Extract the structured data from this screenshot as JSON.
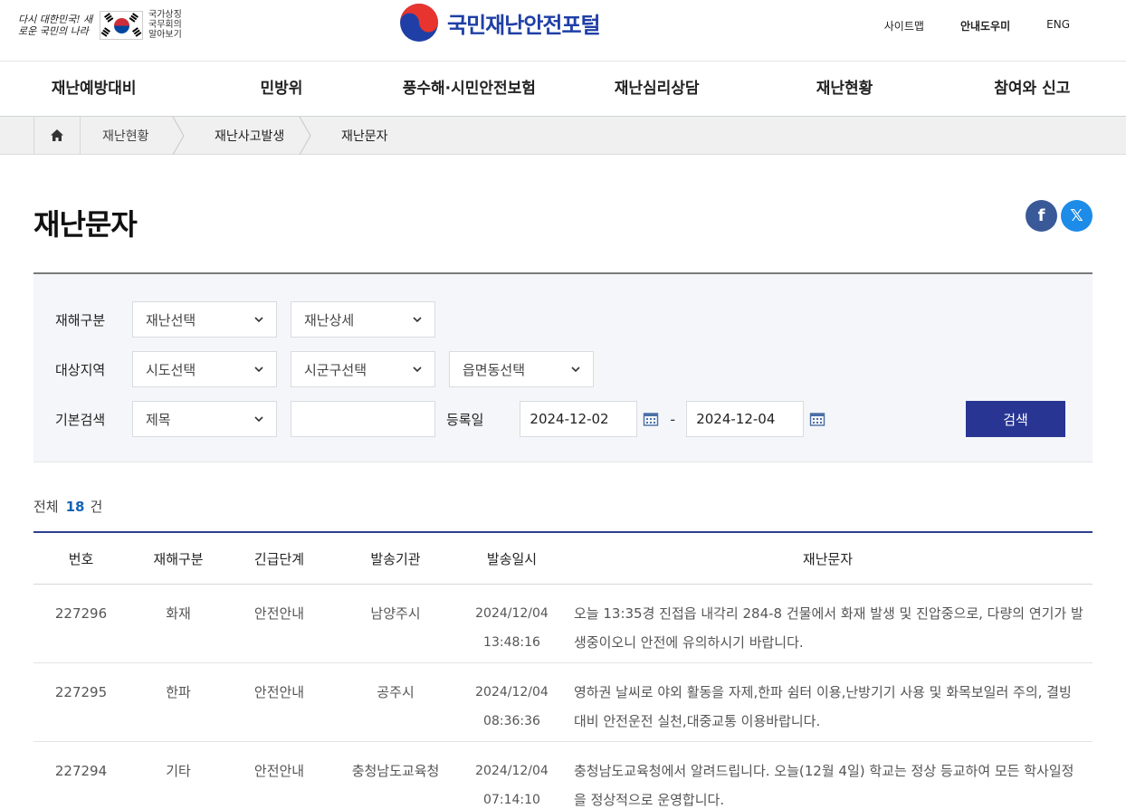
{
  "header": {
    "slogan": "다시 대한민국! 새로운 국민의 나라",
    "gov_lines": [
      "국가상징",
      "국무회의",
      "알아보기"
    ],
    "site_title": "국민재난안전포털",
    "util": [
      "사이트맵",
      "안내도우미",
      "ENG"
    ]
  },
  "gnb": [
    "재난예방대비",
    "민방위",
    "풍수해·시민안전보험",
    "재난심리상담",
    "재난현황",
    "참여와 신고"
  ],
  "breadcrumb": [
    "재난현황",
    "재난사고발생",
    "재난문자"
  ],
  "page_title": "재난문자",
  "share": {
    "facebook": "f",
    "x": "𝕏"
  },
  "search": {
    "labels": {
      "type": "재해구분",
      "region": "대상지역",
      "basic": "기본검색",
      "date": "등록일"
    },
    "disaster_select": "재난선택",
    "disaster_detail": "재난상세",
    "sido": "시도선택",
    "sigungu": "시군구선택",
    "eupmyeon": "읍면동선택",
    "field": "제목",
    "keyword": "",
    "date_from": "2024-12-02",
    "date_to": "2024-12-04",
    "sep": "-",
    "button": "검색"
  },
  "total": {
    "prefix": "전체",
    "count": "18",
    "suffix": "건"
  },
  "table": {
    "headers": [
      "번호",
      "재해구분",
      "긴급단계",
      "발송기관",
      "발송일시",
      "재난문자"
    ],
    "rows": [
      {
        "no": "227296",
        "type": "화재",
        "level": "안전안내",
        "org": "남양주시",
        "date": "2024/12/04",
        "time": "13:48:16",
        "msg": "오늘 13:35경 진접읍 내각리 284-8 건물에서 화재 발생 및 진압중으로, 다량의 연기가 발생중이오니 안전에 유의하시기 바랍니다."
      },
      {
        "no": "227295",
        "type": "한파",
        "level": "안전안내",
        "org": "공주시",
        "date": "2024/12/04",
        "time": "08:36:36",
        "msg": "영하권 날씨로 야외 활동을 자제,한파 쉼터 이용,난방기기 사용 및 화목보일러 주의, 결빙대비 안전운전 실천,대중교통 이용바랍니다."
      },
      {
        "no": "227294",
        "type": "기타",
        "level": "안전안내",
        "org": "충청남도교육청",
        "date": "2024/12/04",
        "time": "07:14:10",
        "msg": "충청남도교육청에서 알려드립니다. 오늘(12월 4일) 학교는 정상 등교하여 모든 학사일정을 정상적으로 운영합니다."
      }
    ]
  }
}
